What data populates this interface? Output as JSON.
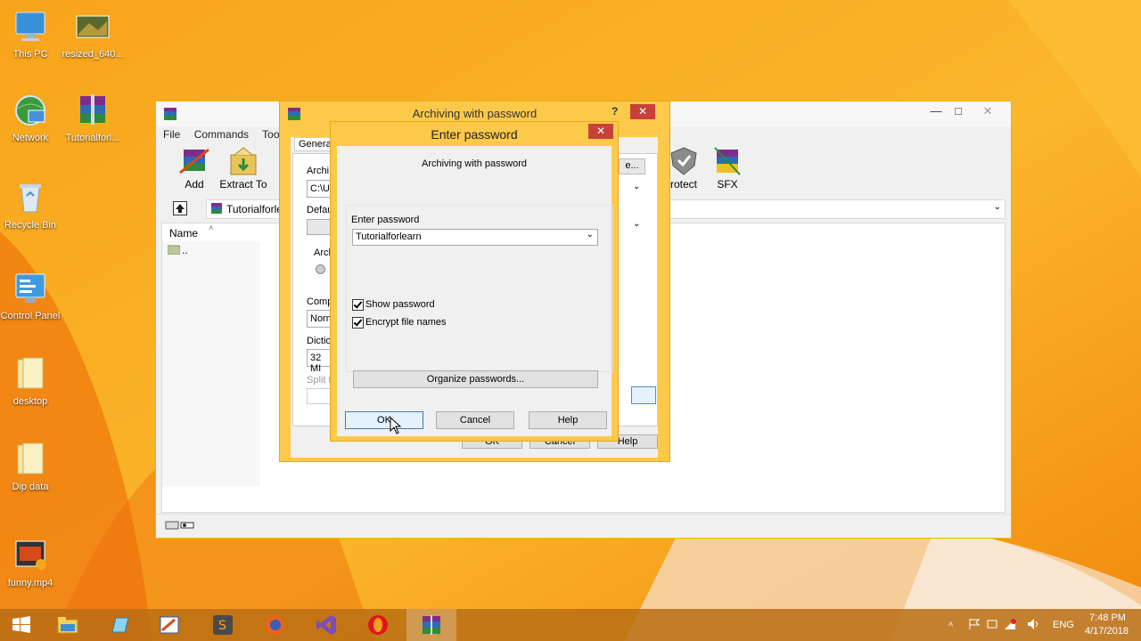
{
  "desktop": {
    "icons": [
      {
        "label": "This PC"
      },
      {
        "label": "resized_640..."
      },
      {
        "label": "Network"
      },
      {
        "label": "Tutorialforl..."
      },
      {
        "label": "Recycle Bin"
      },
      {
        "label": "Control Panel"
      },
      {
        "label": "desktop"
      },
      {
        "label": "Dip data"
      },
      {
        "label": "funny.mp4"
      }
    ]
  },
  "winrar": {
    "menu": [
      "File",
      "Commands",
      "Tools"
    ],
    "toolbar": [
      {
        "label": "Add",
        "icon": "add-archive-icon"
      },
      {
        "label": "Extract To",
        "icon": "extract-to-icon"
      },
      {
        "label": "rotect",
        "icon": "protect-icon"
      },
      {
        "label": "SFX",
        "icon": "sfx-icon"
      }
    ],
    "path_value": "Tutorialforle",
    "column_name": "Name",
    "parent_row": ".."
  },
  "archive_dialog": {
    "title": "Archiving with password",
    "help_glyph": "?",
    "close_glyph": "✕",
    "tab_general": "General",
    "label_archive": "Archi",
    "archive_path": "C:\\U",
    "label_default": "Defau",
    "label_archive_format": "Arch",
    "label_compression": "Comp",
    "compression_value": "Norm",
    "label_dictionary": "Dictio",
    "dictionary_value": "32 MI",
    "label_split": "Split t",
    "ok_label": "OK",
    "cancel_label": "Cancel",
    "help_label": "Help"
  },
  "password_dialog": {
    "title": "Enter password",
    "close_glyph": "✕",
    "heading": "Archiving with password",
    "enter_password_label": "Enter password",
    "password_value": "Tutorialforlearn",
    "show_password_label": "Show password",
    "show_password_checked": true,
    "encrypt_names_label": "Encrypt file names",
    "encrypt_names_checked": true,
    "organize_label": "Organize passwords...",
    "ok_label": "OK",
    "cancel_label": "Cancel",
    "help_label": "Help"
  },
  "taskbar": {
    "language": "ENG",
    "time": "7:48 PM",
    "date": "4/17/2018"
  },
  "colors": {
    "accent_orange": "#f7a81b",
    "dialog_border": "#fcc94a",
    "close_red": "#c7413a"
  }
}
